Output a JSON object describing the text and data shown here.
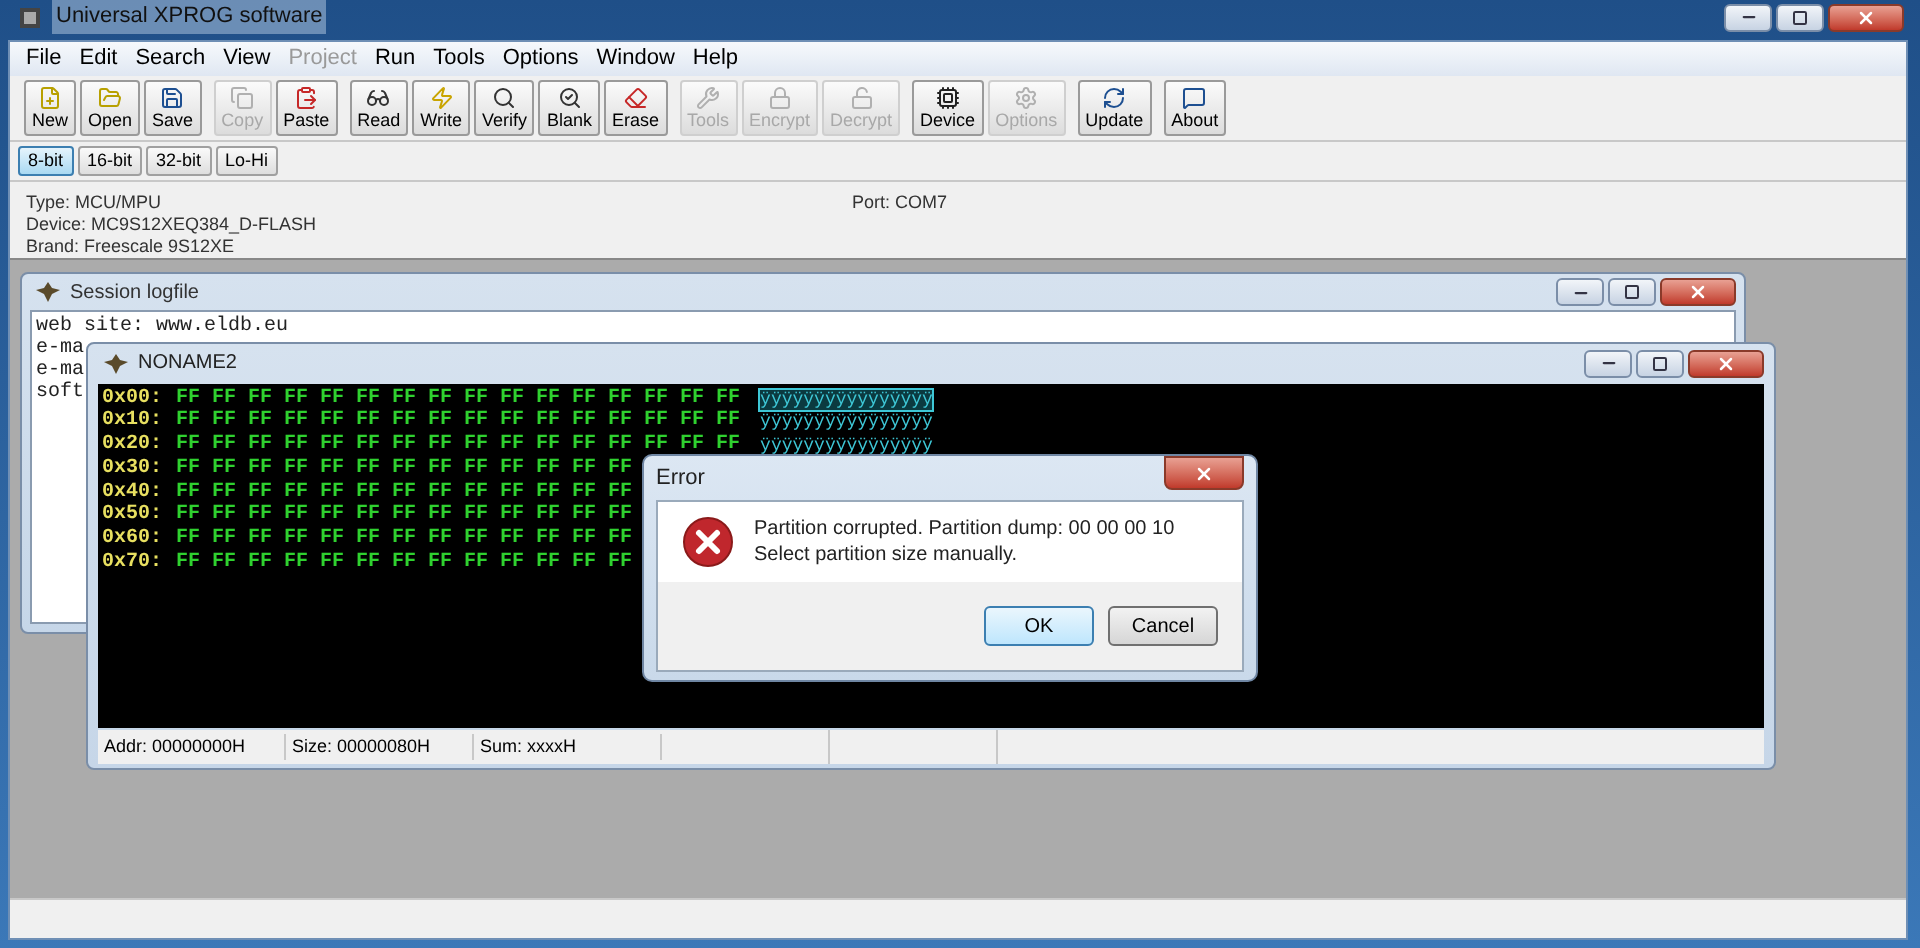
{
  "window": {
    "title": "Universal XPROG software"
  },
  "menu": [
    {
      "label": "File",
      "disabled": false
    },
    {
      "label": "Edit",
      "disabled": false
    },
    {
      "label": "Search",
      "disabled": false
    },
    {
      "label": "View",
      "disabled": false
    },
    {
      "label": "Project",
      "disabled": true
    },
    {
      "label": "Run",
      "disabled": false
    },
    {
      "label": "Tools",
      "disabled": false
    },
    {
      "label": "Options",
      "disabled": false
    },
    {
      "label": "Window",
      "disabled": false
    },
    {
      "label": "Help",
      "disabled": false
    }
  ],
  "toolbar_groups": [
    [
      {
        "label": "New",
        "kind": "new",
        "disabled": false
      },
      {
        "label": "Open",
        "kind": "open",
        "disabled": false
      },
      {
        "label": "Save",
        "kind": "save",
        "disabled": false
      }
    ],
    [
      {
        "label": "Copy",
        "kind": "copy",
        "disabled": true
      },
      {
        "label": "Paste",
        "kind": "paste",
        "disabled": false
      }
    ],
    [
      {
        "label": "Read",
        "kind": "read",
        "disabled": false
      },
      {
        "label": "Write",
        "kind": "write",
        "disabled": false
      },
      {
        "label": "Verify",
        "kind": "verify",
        "disabled": false
      },
      {
        "label": "Blank",
        "kind": "blank",
        "disabled": false
      },
      {
        "label": "Erase",
        "kind": "erase",
        "disabled": false
      }
    ],
    [
      {
        "label": "Tools",
        "kind": "tools",
        "disabled": true
      },
      {
        "label": "Encrypt",
        "kind": "lock",
        "disabled": true
      },
      {
        "label": "Decrypt",
        "kind": "unlock",
        "disabled": true
      }
    ],
    [
      {
        "label": "Device",
        "kind": "device",
        "disabled": false
      },
      {
        "label": "Options",
        "kind": "options",
        "disabled": true
      }
    ],
    [
      {
        "label": "Update",
        "kind": "update",
        "disabled": false
      }
    ],
    [
      {
        "label": "About",
        "kind": "about",
        "disabled": false
      }
    ]
  ],
  "bit_modes": [
    {
      "label": "8-bit",
      "selected": true
    },
    {
      "label": "16-bit",
      "selected": false
    },
    {
      "label": "32-bit",
      "selected": false
    },
    {
      "label": "Lo-Hi",
      "selected": false
    }
  ],
  "info": {
    "type": "Type: MCU/MPU",
    "device": "Device: MC9S12XEQ384_D-FLASH",
    "brand": "Brand: Freescale 9S12XE",
    "port": "Port: COM7"
  },
  "session_log": {
    "title": "Session logfile",
    "lines": [
      "web site: www.eldb.eu",
      "e-ma",
      "e-ma",
      "soft"
    ]
  },
  "hex_window": {
    "title": "NONAME2",
    "rows": [
      {
        "address": "0x00:",
        "bytes": "FF FF FF FF FF FF FF FF FF FF FF FF FF FF FF FF",
        "ascii": "ÿÿÿÿÿÿÿÿÿÿÿÿÿÿÿÿ",
        "cursor": true
      },
      {
        "address": "0x10:",
        "bytes": "FF FF FF FF FF FF FF FF FF FF FF FF FF FF FF FF",
        "ascii": "ÿÿÿÿÿÿÿÿÿÿÿÿÿÿÿÿ",
        "cursor": false
      },
      {
        "address": "0x20:",
        "bytes": "FF FF FF FF FF FF FF FF FF FF FF FF FF FF FF FF",
        "ascii": "ÿÿÿÿÿÿÿÿÿÿÿÿÿÿÿÿ",
        "cursor": false
      },
      {
        "address": "0x30:",
        "bytes": "FF FF FF FF FF FF FF FF FF FF FF FF FF"
      },
      {
        "address": "0x40:",
        "bytes": "FF FF FF FF FF FF FF FF FF FF FF FF FF"
      },
      {
        "address": "0x50:",
        "bytes": "FF FF FF FF FF FF FF FF FF FF FF FF FF"
      },
      {
        "address": "0x60:",
        "bytes": "FF FF FF FF FF FF FF FF FF FF FF FF FF"
      },
      {
        "address": "0x70:",
        "bytes": "FF FF FF FF FF FF FF FF FF FF FF FF FF"
      }
    ],
    "status": [
      "Addr: 00000000H",
      "Size: 00000080H",
      "Sum: xxxxH"
    ]
  },
  "error_dialog": {
    "title": "Error",
    "message_lines": [
      "Partition corrupted. Partition dump: 00 00 00 10",
      "Select partition size manually."
    ],
    "buttons": [
      {
        "label": "OK",
        "default": true
      },
      {
        "label": "Cancel",
        "default": false
      }
    ]
  }
}
